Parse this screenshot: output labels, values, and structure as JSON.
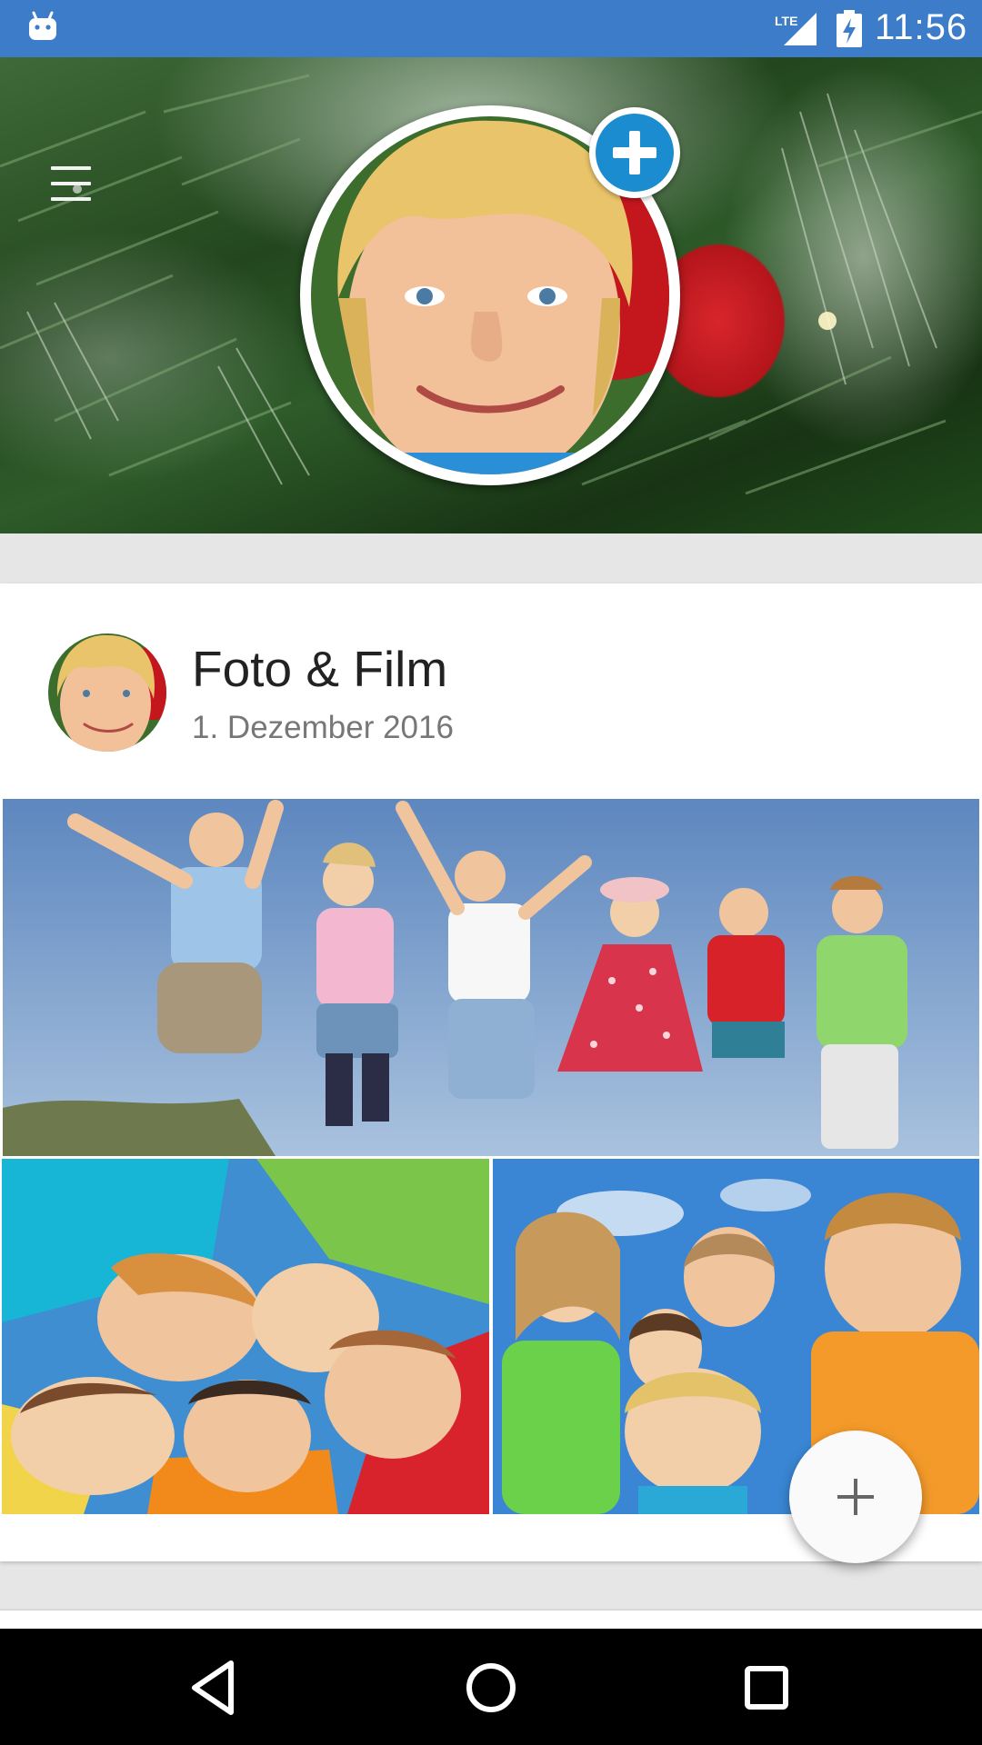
{
  "status_bar": {
    "network": "LTE",
    "time": "11:56"
  },
  "header": {
    "menu_icon": "hamburger-menu-icon",
    "add_icon": "add-photo-plus-icon"
  },
  "post": {
    "title": "Foto & Film",
    "date": "1. Dezember 2016"
  },
  "fab": {
    "icon": "plus-icon"
  },
  "nav_bar": {
    "back_icon": "back-triangle-icon",
    "home_icon": "home-circle-icon",
    "recents_icon": "recents-square-icon"
  },
  "colors": {
    "status_bar": "#3d7cc9",
    "accent_blue": "#1a8ccf",
    "title_text": "#222222",
    "date_text": "#777777"
  }
}
